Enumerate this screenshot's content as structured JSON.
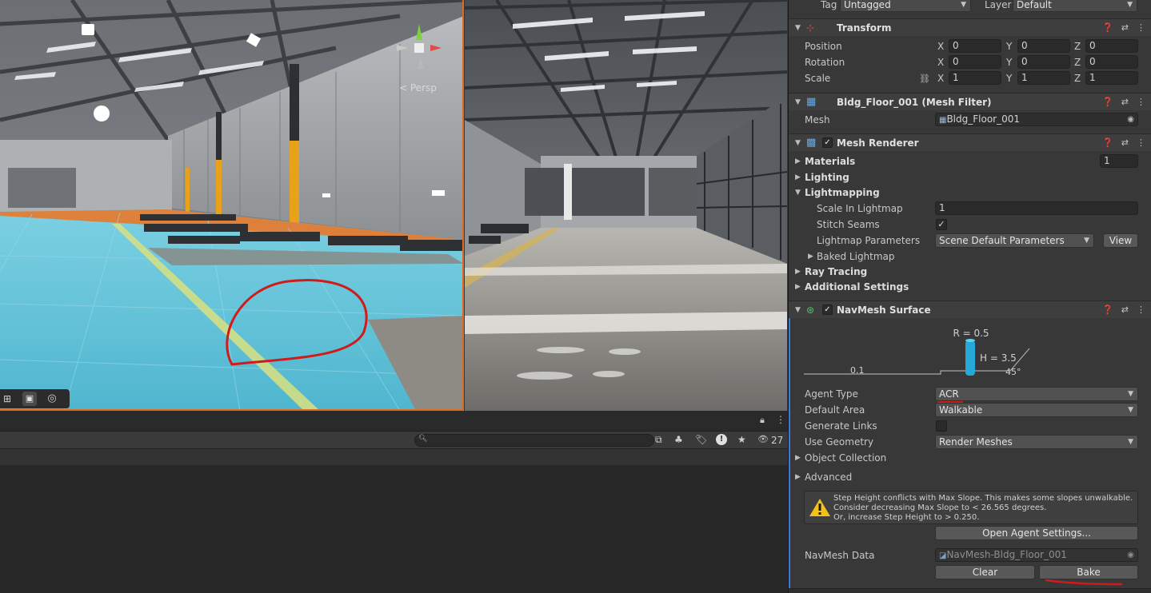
{
  "scene": {
    "persp_label": "< Persp"
  },
  "console": {
    "search_placeholder": "",
    "count": "27"
  },
  "inspector": {
    "tag_label": "Tag",
    "tag_value": "Untagged",
    "layer_label": "Layer",
    "layer_value": "Default",
    "transform": {
      "title": "Transform",
      "position_label": "Position",
      "rotation_label": "Rotation",
      "scale_label": "Scale",
      "x": "X",
      "y": "Y",
      "z": "Z",
      "position": [
        "0",
        "0",
        "0"
      ],
      "rotation": [
        "0",
        "0",
        "0"
      ],
      "scale": [
        "1",
        "1",
        "1"
      ]
    },
    "mesh_filter": {
      "title": "Bldg_Floor_001 (Mesh Filter)",
      "mesh_label": "Mesh",
      "mesh_value": "Bldg_Floor_001"
    },
    "mesh_renderer": {
      "title": "Mesh Renderer",
      "materials_label": "Materials",
      "materials_count": "1",
      "lighting_label": "Lighting",
      "lightmapping_label": "Lightmapping",
      "scale_in_lightmap_label": "Scale In Lightmap",
      "scale_in_lightmap_value": "1",
      "stitch_seams_label": "Stitch Seams",
      "lightmap_params_label": "Lightmap Parameters",
      "lightmap_params_value": "Scene Default Parameters",
      "view_button": "View",
      "baked_lightmap_label": "Baked Lightmap",
      "ray_tracing_label": "Ray Tracing",
      "additional_settings_label": "Additional Settings"
    },
    "navmesh": {
      "title": "NavMesh Surface",
      "diagram": {
        "r_label": "R = 0.5",
        "h_label": "H = 3.5",
        "slope_label": "45°",
        "step_label": "0.1"
      },
      "agent_type_label": "Agent Type",
      "agent_type_value": "ACR",
      "default_area_label": "Default Area",
      "default_area_value": "Walkable",
      "generate_links_label": "Generate Links",
      "use_geometry_label": "Use Geometry",
      "use_geometry_value": "Render Meshes",
      "object_collection_label": "Object Collection",
      "advanced_label": "Advanced",
      "warning_line1": "Step Height conflicts with Max Slope. This makes some slopes unwalkable.",
      "warning_line2": "Consider decreasing Max Slope to < 26.565 degrees.",
      "warning_line3": "Or, increase Step Height to > 0.250.",
      "open_agent_settings_button": "Open Agent Settings...",
      "navmesh_data_label": "NavMesh Data",
      "navmesh_data_value": "NavMesh-Bldg_Floor_001",
      "clear_button": "Clear",
      "bake_button": "Bake"
    }
  },
  "colors": {
    "annotation_red": "#d11a1a",
    "navmesh_blue": "#5fc6dc",
    "selection_orange": "#e06a1e"
  }
}
